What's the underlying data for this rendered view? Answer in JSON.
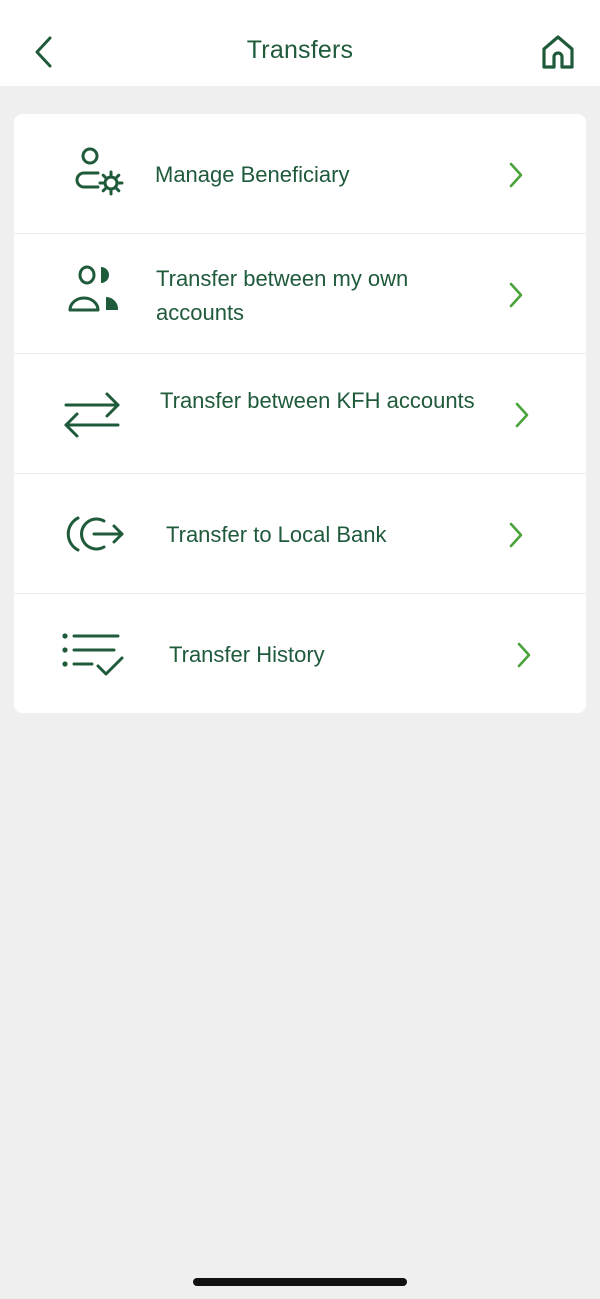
{
  "header": {
    "title": "Transfers",
    "back_icon": "chevron-left-icon",
    "home_icon": "home-icon"
  },
  "menu": {
    "items": [
      {
        "label": "Manage Beneficiary",
        "icon": "user-gear-icon"
      },
      {
        "label": "Transfer between my own accounts",
        "line1": "Transfer between my own",
        "line2": "accounts",
        "icon": "users-icon"
      },
      {
        "label": "Transfer between KFH accounts",
        "icon": "swap-arrows-icon"
      },
      {
        "label": "Transfer to Local Bank",
        "icon": "bank-exit-icon"
      },
      {
        "label": "Transfer History",
        "icon": "list-check-icon"
      }
    ]
  },
  "colors": {
    "primary": "#1f5a3b",
    "accent": "#4aa23a",
    "background": "#efefef",
    "card": "#ffffff"
  }
}
